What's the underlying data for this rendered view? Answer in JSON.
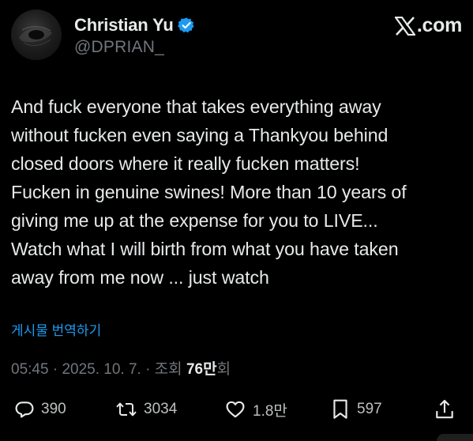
{
  "user": {
    "display_name": "Christian Yu",
    "handle": "@DPRIAN_",
    "verified_badge_color": "#1d9bf0"
  },
  "brand": {
    "label": ".com",
    "logo_icon": "x-logo-icon"
  },
  "tweet": {
    "lines": [
      "And fuck everyone that takes everything away",
      "without fucken even saying a Thankyou behind",
      "closed doors where it really fucken matters!",
      "Fucken in genuine swines! More than 10 years of",
      "giving me up at the expense for you to LIVE...",
      "Watch what I will birth from what you have taken",
      "away from me now ... just watch"
    ]
  },
  "translate_label": "게시물 번역하기",
  "meta": {
    "time": "05:45",
    "separator": " · ",
    "date": "2025. 10. 7.",
    "views_prefix": "조회 ",
    "views_count": "76만",
    "views_suffix": "회"
  },
  "actions": {
    "replies": "390",
    "reposts": "3034",
    "likes": "1.8만",
    "bookmarks": "597"
  },
  "colors": {
    "background": "#000000",
    "text_primary": "#e7e9ea",
    "text_secondary": "#71767b",
    "link": "#1d9bf0"
  }
}
